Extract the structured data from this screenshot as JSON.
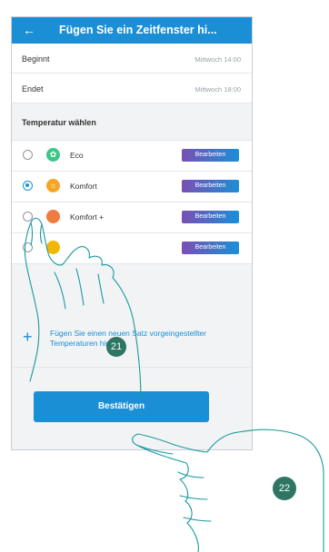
{
  "header": {
    "back_icon": "arrow-left-icon",
    "title": "Fügen Sie ein Zeitfenster hi..."
  },
  "schedule": {
    "begin_label": "Beginnt",
    "begin_value": "Mittwoch 14:00",
    "end_label": "Endet",
    "end_value": "Mittwoch 18:00"
  },
  "temperature": {
    "section_title": "Temperatur wählen",
    "items": [
      {
        "name": "Eco",
        "selected": false,
        "icon": "leaf-icon",
        "color": "#3cc68a",
        "edit_label": "Bearbeiten"
      },
      {
        "name": "Komfort",
        "selected": true,
        "icon": "sun-icon",
        "color": "#f5a623",
        "edit_label": "Bearbeiten"
      },
      {
        "name": "Komfort +",
        "selected": false,
        "icon": "flame-icon",
        "color": "#f07b3f",
        "edit_label": "Bearbeiten"
      },
      {
        "name": "",
        "selected": false,
        "icon": "",
        "color": "#f2b705",
        "edit_label": "Bearbeiten"
      }
    ]
  },
  "add_set": {
    "icon": "plus-icon",
    "text": "Fügen Sie einen neuen Satz vorgeingestellter Temperaturen hinzu"
  },
  "confirm_label": "Bestätigen",
  "annotations": {
    "step_one": "21",
    "step_two": "22"
  },
  "colors": {
    "accent": "#1b8fd6",
    "badge": "#2f7564"
  }
}
